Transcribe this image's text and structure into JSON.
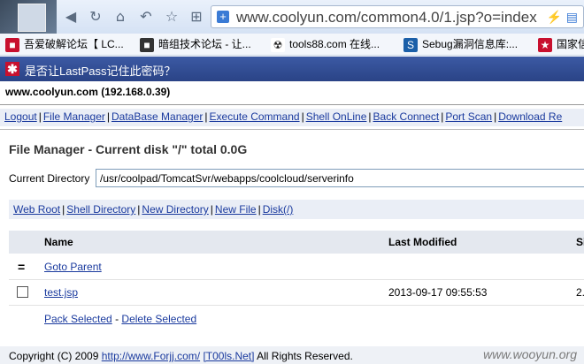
{
  "browser": {
    "url": "www.coolyun.com/common4.0/1.jsp?o=index",
    "bookmarks": [
      {
        "label": "吾爱破解论坛【 LC...",
        "icon": "red-square-icon",
        "color": "#c8102e"
      },
      {
        "label": "暗组技术论坛 - 让...",
        "icon": "dark-square-icon",
        "color": "#333333"
      },
      {
        "label": "tools88.com 在线...",
        "icon": "radiation-icon",
        "color": "#222222"
      },
      {
        "label": "Sebug漏洞信息库:...",
        "icon": "s-logo-icon",
        "color": "#1b5fa8"
      },
      {
        "label": "国家信",
        "icon": "gov-icon",
        "color": "#c8102e"
      }
    ]
  },
  "lastpass": {
    "message": "是否让LastPass记住此密码？",
    "icon_glyph": "✱"
  },
  "host": "www.coolyun.com (192.168.0.39)",
  "menu": [
    "Logout",
    "File Manager",
    "DataBase Manager",
    "Execute Command",
    "Shell OnLine",
    "Back Connect",
    "Port Scan",
    "Download Re"
  ],
  "file_manager": {
    "title": "File Manager - Current disk \"/\" total 0.0G",
    "dir_label": "Current Directory",
    "dir_value": "/usr/coolpad/TomcatSvr/webapps/coolcloud/serverinfo",
    "subnav": [
      "Web Root",
      "Shell Directory",
      "New Directory",
      "New File",
      "Disk(/)"
    ],
    "columns": {
      "name": "Name",
      "modified": "Last Modified",
      "size": "Si"
    },
    "parent_glyph": "=",
    "parent_label": "Goto Parent",
    "files": [
      {
        "name": "test.jsp",
        "modified": "2013-09-17 09:55:53",
        "size": "2."
      }
    ],
    "pack_label": "Pack Selected",
    "delete_label": "Delete Selected",
    "action_sep": "-"
  },
  "footer": {
    "copyright": "Copyright (C) 2009",
    "link1": "http://www.Forjj.com/",
    "link2": "[T00ls.Net]",
    "rights": "All Rights Reserved."
  },
  "watermark": "www.wooyun.org"
}
